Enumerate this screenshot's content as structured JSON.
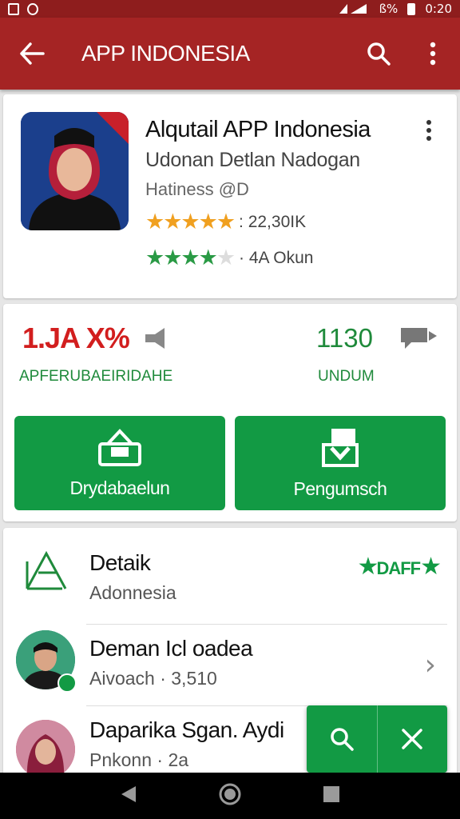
{
  "status_bar": {
    "battery_text": "ß%",
    "time": "0:20"
  },
  "app_bar": {
    "title": "APP INDONESIA"
  },
  "app_card": {
    "title": "Alqutail APP Indonesia",
    "developer": "Udonan Detlan Nadogan",
    "category": "Hatiness @D",
    "rating_1": {
      "stars": 5,
      "count_text": ": 22,30IK"
    },
    "rating_2": {
      "stars": 3.5,
      "count_text": "· 4A Okun"
    }
  },
  "stats_card": {
    "left_value": "1.JA X%",
    "left_label": "APFERUBAEIRIDAHE",
    "right_value": "1130",
    "right_label": "UNDUM",
    "buttons": [
      {
        "label": "Drydabaelun",
        "icon": "gift-box-icon"
      },
      {
        "label": "Pengumsch",
        "icon": "download-icon"
      }
    ]
  },
  "list_card": {
    "items": [
      {
        "title": "Detaik",
        "subtitle": "Adonnesia",
        "icon": "detail-icon",
        "badge_text": "DAFF"
      },
      {
        "title": "Deman Icl oadea",
        "subtitle": "Aivoach · 3,510",
        "icon": "avatar"
      },
      {
        "title": "Daparika Sgan. Aydi",
        "subtitle": "Pnkonn · 2a",
        "icon": "avatar"
      }
    ]
  },
  "colors": {
    "status_bar": "#8e1d1d",
    "app_bar": "#a52424",
    "accent_green": "#129a44",
    "accent_red": "#d21e1e",
    "star_orange": "#f0a020"
  }
}
